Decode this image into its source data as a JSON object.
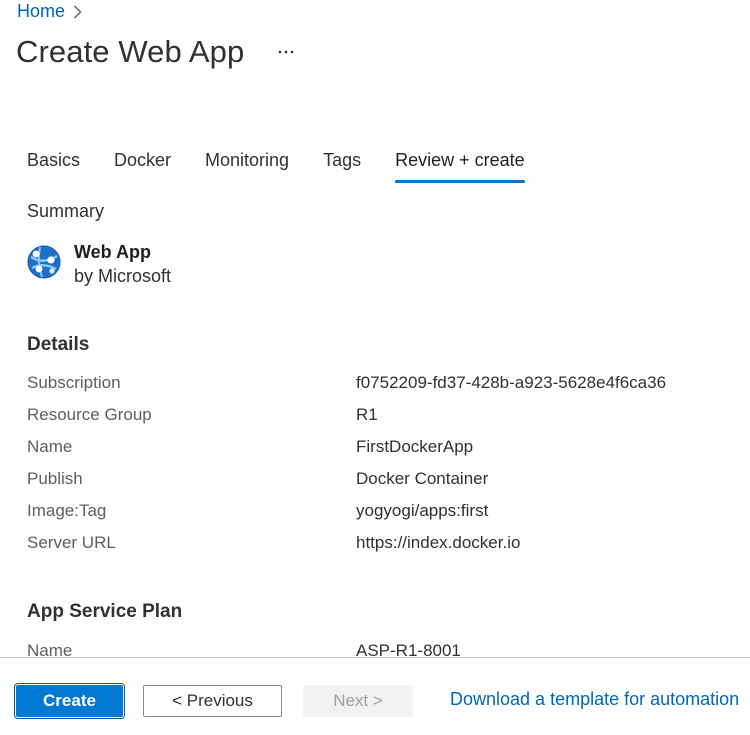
{
  "breadcrumb": {
    "home_label": "Home"
  },
  "header": {
    "title": "Create Web App",
    "more_label": "..."
  },
  "tabs": [
    {
      "label": "Basics",
      "active": false
    },
    {
      "label": "Docker",
      "active": false
    },
    {
      "label": "Monitoring",
      "active": false
    },
    {
      "label": "Tags",
      "active": false
    },
    {
      "label": "Review + create",
      "active": true
    }
  ],
  "summary": {
    "label": "Summary",
    "product_name": "Web App",
    "product_vendor": "by Microsoft",
    "product_icon": "web-app-icon"
  },
  "details": {
    "heading": "Details",
    "rows": [
      {
        "key": "Subscription",
        "value": "f0752209-fd37-428b-a923-5628e4f6ca36"
      },
      {
        "key": "Resource Group",
        "value": "R1"
      },
      {
        "key": "Name",
        "value": "FirstDockerApp"
      },
      {
        "key": "Publish",
        "value": "Docker Container"
      },
      {
        "key": "Image:Tag",
        "value": "yogyogi/apps:first"
      },
      {
        "key": "Server URL",
        "value": "https://index.docker.io"
      }
    ]
  },
  "app_service_plan": {
    "heading": "App Service Plan",
    "rows": [
      {
        "key": "Name",
        "value": "ASP-R1-8001"
      }
    ]
  },
  "footer": {
    "create_label": "Create",
    "previous_label": "< Previous",
    "next_label": "Next >",
    "download_label": "Download a template for automation"
  },
  "colors": {
    "accent": "#0078d4",
    "link": "#0067b8",
    "text": "#323130",
    "muted": "#605e5c",
    "disabled_bg": "#f3f2f1",
    "disabled_text": "#a19f9d"
  }
}
